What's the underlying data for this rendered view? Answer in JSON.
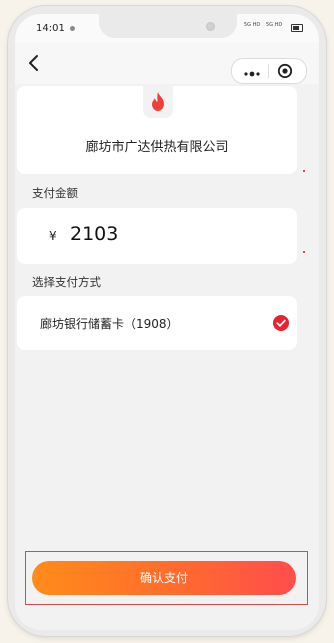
{
  "status_bar": {
    "time": "14:01",
    "signal_1": "5G HD",
    "signal_2": "5G HD"
  },
  "nav": {
    "back_icon": "chevron-left-icon",
    "more_icon": "more-dots-icon",
    "target_icon": "target-icon"
  },
  "merchant": {
    "logo_icon": "flame-icon",
    "name": "廊坊市广达供热有限公司"
  },
  "amount_section": {
    "label": "支付金额",
    "currency": "¥",
    "value": "2103"
  },
  "method_section": {
    "label": "选择支付方式",
    "bank": "廊坊银行储蓄卡（1908）",
    "check_icon": "check-circle-icon"
  },
  "confirm_button": {
    "label": "确认支付"
  },
  "colors": {
    "accent_start": "#ff8c1a",
    "accent_end": "#ff4d4d",
    "check_red": "#e8222e",
    "flame_red": "#ef3f3a",
    "highlight_border": "#d64a4a"
  }
}
